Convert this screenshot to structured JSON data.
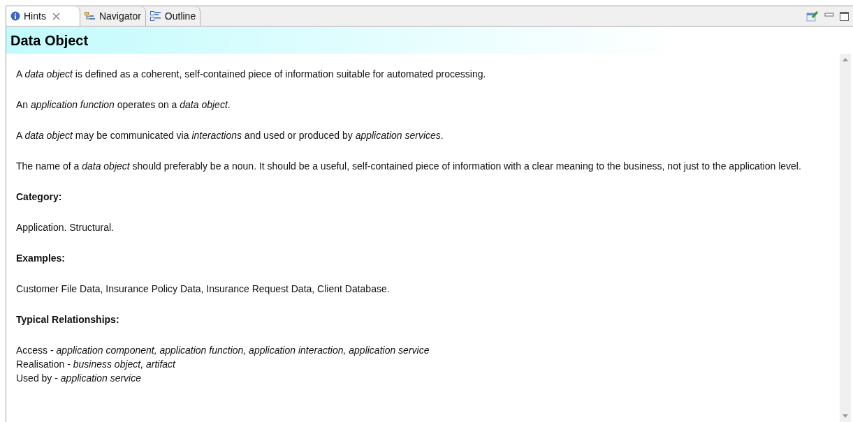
{
  "tabs": [
    {
      "label": "Hints",
      "kind": "hints",
      "selected": true,
      "closable": true
    },
    {
      "label": "Navigator",
      "kind": "navigator",
      "selected": false,
      "closable": false
    },
    {
      "label": "Outline",
      "kind": "outline",
      "selected": false,
      "closable": false
    }
  ],
  "title": "Data Object",
  "blocks": [
    {
      "kind": "para",
      "text": "A *data object* is defined as a coherent, self-contained piece of information suitable for automated processing."
    },
    {
      "kind": "para",
      "text": "An *application function* operates on a *data object*."
    },
    {
      "kind": "para",
      "text": "A *data object* may be communicated via *interactions* and used or produced by *application services*."
    },
    {
      "kind": "para",
      "text": "The name of a *data object* should preferably be a noun. It should be a useful, self-contained piece of information with a clear meaning to the business, not just to the application level."
    },
    {
      "kind": "heading",
      "text": "Category:"
    },
    {
      "kind": "para",
      "text": "Application. Structural."
    },
    {
      "kind": "heading",
      "text": "Examples:"
    },
    {
      "kind": "para",
      "text": "Customer File Data, Insurance Policy Data, Insurance Request Data, Client Database."
    },
    {
      "kind": "heading",
      "text": "Typical Relationships:"
    },
    {
      "kind": "lines",
      "lines": [
        "Access - *application component, application function, application interaction, application service*",
        "Realisation - *business object, artifact*",
        "Used by - *application service*"
      ]
    }
  ]
}
